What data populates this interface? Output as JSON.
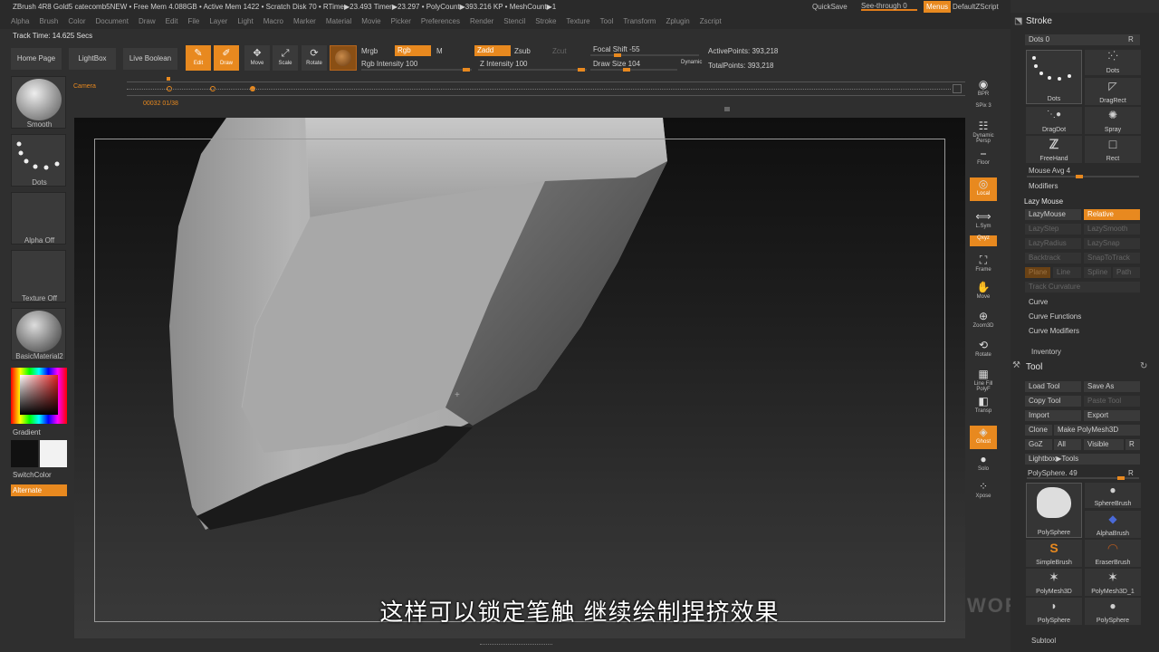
{
  "title_bar": {
    "text": "ZBrush 4R8 Gold5   catecomb5NEW   • Free Mem 4.088GB • Active Mem 1422 • Scratch Disk 70 • RTime▶23.493 Timer▶23.297 • PolyCount▶393.216 KP • MeshCount▶1",
    "quicksave": "QuickSave",
    "seethrough": "See-through  0",
    "menus": "Menus",
    "default_zscript": "DefaultZScript"
  },
  "menu": [
    "Alpha",
    "Brush",
    "Color",
    "Document",
    "Draw",
    "Edit",
    "File",
    "Layer",
    "Light",
    "Macro",
    "Marker",
    "Material",
    "Movie",
    "Picker",
    "Preferences",
    "Render",
    "Stencil",
    "Stroke",
    "Texture",
    "Tool",
    "Transform",
    "Zplugin",
    "Zscript"
  ],
  "track_time": "Track Time: 14.625 Secs",
  "toolbar": {
    "home": "Home Page",
    "lightbox": "LightBox",
    "live_boolean": "Live Boolean",
    "modes": [
      {
        "label": "Edit",
        "glyph": "✎",
        "active": true
      },
      {
        "label": "Draw",
        "glyph": "✐",
        "active": true
      },
      {
        "label": "Move",
        "glyph": "✥",
        "active": false
      },
      {
        "label": "Scale",
        "glyph": "⤢",
        "active": false
      },
      {
        "label": "Rotate",
        "glyph": "⟳",
        "active": false
      }
    ],
    "mrgb": "Mrgb",
    "rgb": "Rgb",
    "m": "M",
    "rgb_intensity": "Rgb Intensity 100",
    "zadd": "Zadd",
    "zsub": "Zsub",
    "zcut": "Zcut",
    "z_intensity": "Z Intensity 100",
    "focal_shift": "Focal Shift -55",
    "draw_size": "Draw Size 104",
    "dynamic": "Dynamic",
    "active_points": "ActivePoints: 393,218",
    "total_points": "TotalPoints: 393,218"
  },
  "timeline": {
    "camera": "Camera",
    "time_labels": "00032  01/38"
  },
  "left_panel": {
    "brush": "Smooth",
    "stroke": "Dots",
    "alpha": "Alpha Off",
    "texture": "Texture Off",
    "material": "BasicMaterial2",
    "gradient": "Gradient",
    "switch_color": "SwitchColor",
    "alternate": "Alternate"
  },
  "right_shelf": [
    {
      "label": "BPR",
      "glyph": "◉",
      "active": false
    },
    {
      "label": "SPix 3",
      "glyph": "",
      "active": false
    },
    {
      "label": "Dynamic Persp",
      "glyph": "☷",
      "active": false
    },
    {
      "label": "Floor",
      "glyph": "⎯",
      "active": false
    },
    {
      "label": "Local",
      "glyph": "◎",
      "active": true
    },
    {
      "label": "L.Sym",
      "glyph": "⟺",
      "active": false
    },
    {
      "label": "Qxyz",
      "glyph": "",
      "active": true
    },
    {
      "label": "Frame",
      "glyph": "⛶",
      "active": false
    },
    {
      "label": "Move",
      "glyph": "✋",
      "active": false
    },
    {
      "label": "Zoom3D",
      "glyph": "⊕",
      "active": false
    },
    {
      "label": "Rotate",
      "glyph": "⟲",
      "active": false
    },
    {
      "label": "Line Fill PolyF",
      "glyph": "▦",
      "active": false
    },
    {
      "label": "Transp",
      "glyph": "◧",
      "active": false
    },
    {
      "label": "Ghost",
      "glyph": "◈",
      "active": true
    },
    {
      "label": "Solo",
      "glyph": "●",
      "active": false
    },
    {
      "label": "Xpose",
      "glyph": "⁘",
      "active": false
    }
  ],
  "stroke_panel": {
    "title": "Stroke",
    "dots": "Dots  0",
    "r": "R",
    "thumbs": [
      "Dots",
      "Dots",
      "DragRect",
      "DragDot",
      "Spray",
      "FreeHand",
      "Rect"
    ],
    "mouse_avg": "Mouse Avg 4",
    "modifiers": "Modifiers",
    "lazy_mouse_header": "Lazy Mouse",
    "lazy_mouse": "LazyMouse",
    "relative": "Relative",
    "lazy_step": "LazyStep",
    "lazy_smooth": "LazySmooth",
    "lazy_radius": "LazyRadius",
    "lazy_snap": "LazySnap",
    "backtrack": "Backtrack",
    "snap_to_track": "SnapToTrack",
    "plane": "Plane",
    "line": "Line",
    "spline": "Spline",
    "path": "Path",
    "track_curvature": "Track Curvature",
    "curve": "Curve",
    "curve_functions": "Curve Functions",
    "curve_modifiers": "Curve Modifiers",
    "inventory": "Inventory"
  },
  "tool_panel": {
    "title": "Tool",
    "load_tool": "Load Tool",
    "save_as": "Save As",
    "copy_tool": "Copy Tool",
    "paste_tool": "Paste Tool",
    "import": "Import",
    "export": "Export",
    "clone": "Clone",
    "make_polymesh": "Make PolyMesh3D",
    "goz": "GoZ",
    "all": "All",
    "visible": "Visible",
    "r": "R",
    "lightbox_tools": "Lightbox▶Tools",
    "polysphere": "PolySphere. 49",
    "thumbs": [
      "PolySphere",
      "SphereBrush",
      "AlphaBrush",
      "SimpleBrush",
      "EraserBrush",
      "PolyMesh3D",
      "PolyMesh3D_1",
      "PolySphere",
      "PolySphere"
    ],
    "subtool": "Subtool"
  },
  "subtitle": "这样可以锁定笔触 继续绘制捏挤效果",
  "colors": {
    "accent": "#e8891f",
    "bg": "#2f2f2f"
  }
}
